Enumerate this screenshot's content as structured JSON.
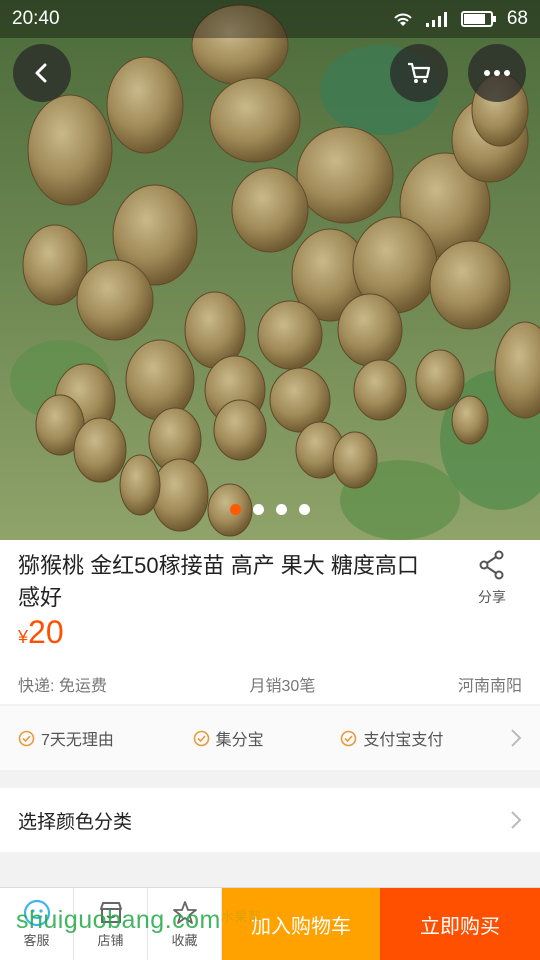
{
  "status_bar": {
    "time": "20:40",
    "battery": "68"
  },
  "product": {
    "title": "猕猴桃 金红50稼接苗 高产 果大 糖度高口感好",
    "price_symbol": "¥",
    "price": "20",
    "shipping": "快递: 免运费",
    "monthly_sales": "月销30笔",
    "location": "河南南阳"
  },
  "share": {
    "label": "分享",
    "icon": "share-icon"
  },
  "carousel": {
    "count": 4,
    "active_index": 0
  },
  "guarantees": [
    {
      "label": "7天无理由",
      "icon": "check-circle-icon"
    },
    {
      "label": "集分宝",
      "icon": "check-circle-icon"
    },
    {
      "label": "支付宝支付",
      "icon": "check-circle-icon"
    }
  ],
  "sku": {
    "label": "选择颜色分类"
  },
  "bottom_bar": {
    "customer_service": "客服",
    "shop": "店铺",
    "favorite": "收藏",
    "add_to_cart": "加入购物车",
    "buy_now": "立即购买"
  },
  "watermark": {
    "text": "shuiguobang.com",
    "small": "水果帮"
  },
  "colors": {
    "accent": "#ff5000",
    "cart_orange": "#ffa200",
    "check_orange": "#e89a3c",
    "service_blue": "#3db4f0"
  }
}
